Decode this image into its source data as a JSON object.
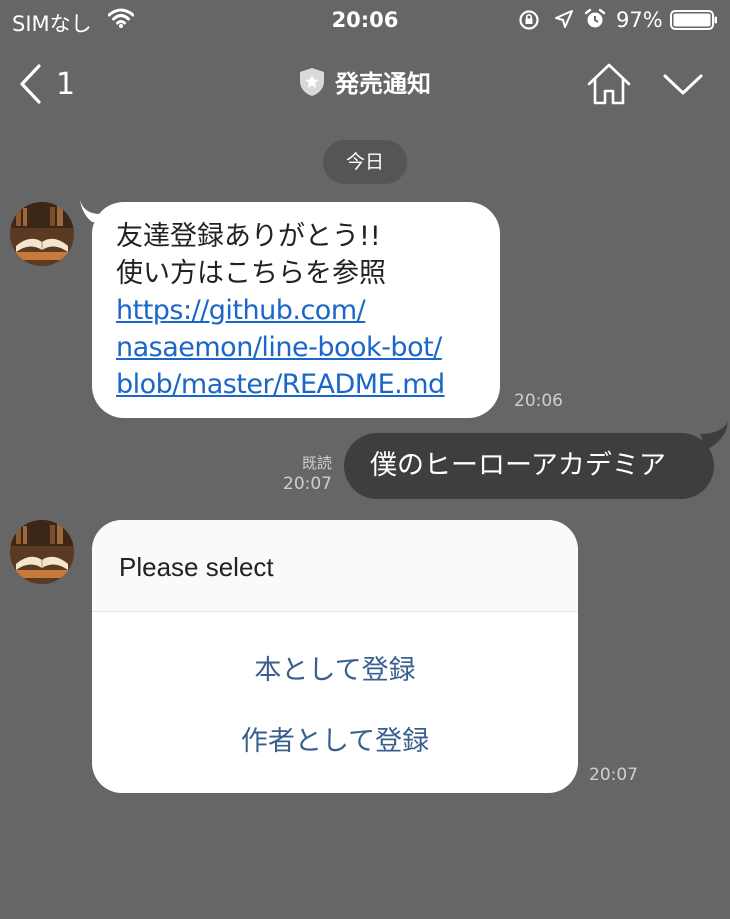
{
  "status_bar": {
    "carrier": "SIMなし",
    "time": "20:06",
    "battery_percent": "97%",
    "icons": [
      "wifi-icon",
      "rotation-lock-icon",
      "location-arrow-icon",
      "alarm-icon",
      "battery-icon"
    ]
  },
  "nav": {
    "back_count": "1",
    "title": "発売通知",
    "icons": [
      "back-chevron-icon",
      "official-shield-icon",
      "home-icon",
      "chevron-down-icon"
    ]
  },
  "date_divider": "今日",
  "messages": {
    "welcome": {
      "lines": [
        "友達登録ありがとう!!",
        "使い方はこちらを参照"
      ],
      "link_lines": [
        "https://github.com/",
        "nasaemon/line-book-bot/",
        "blob/master/README.md"
      ],
      "time": "20:06"
    },
    "sent": {
      "text": "僕のヒーローアカデミア",
      "read_label": "既読",
      "time": "20:07"
    },
    "select_card": {
      "title": "Please select",
      "actions": [
        "本として登録",
        "作者として登録"
      ],
      "time": "20:07"
    }
  },
  "colors": {
    "background": "#666666",
    "link": "#1a66c9",
    "action_text": "#3a5f8e",
    "sent_bubble": "#3e3e3e"
  }
}
